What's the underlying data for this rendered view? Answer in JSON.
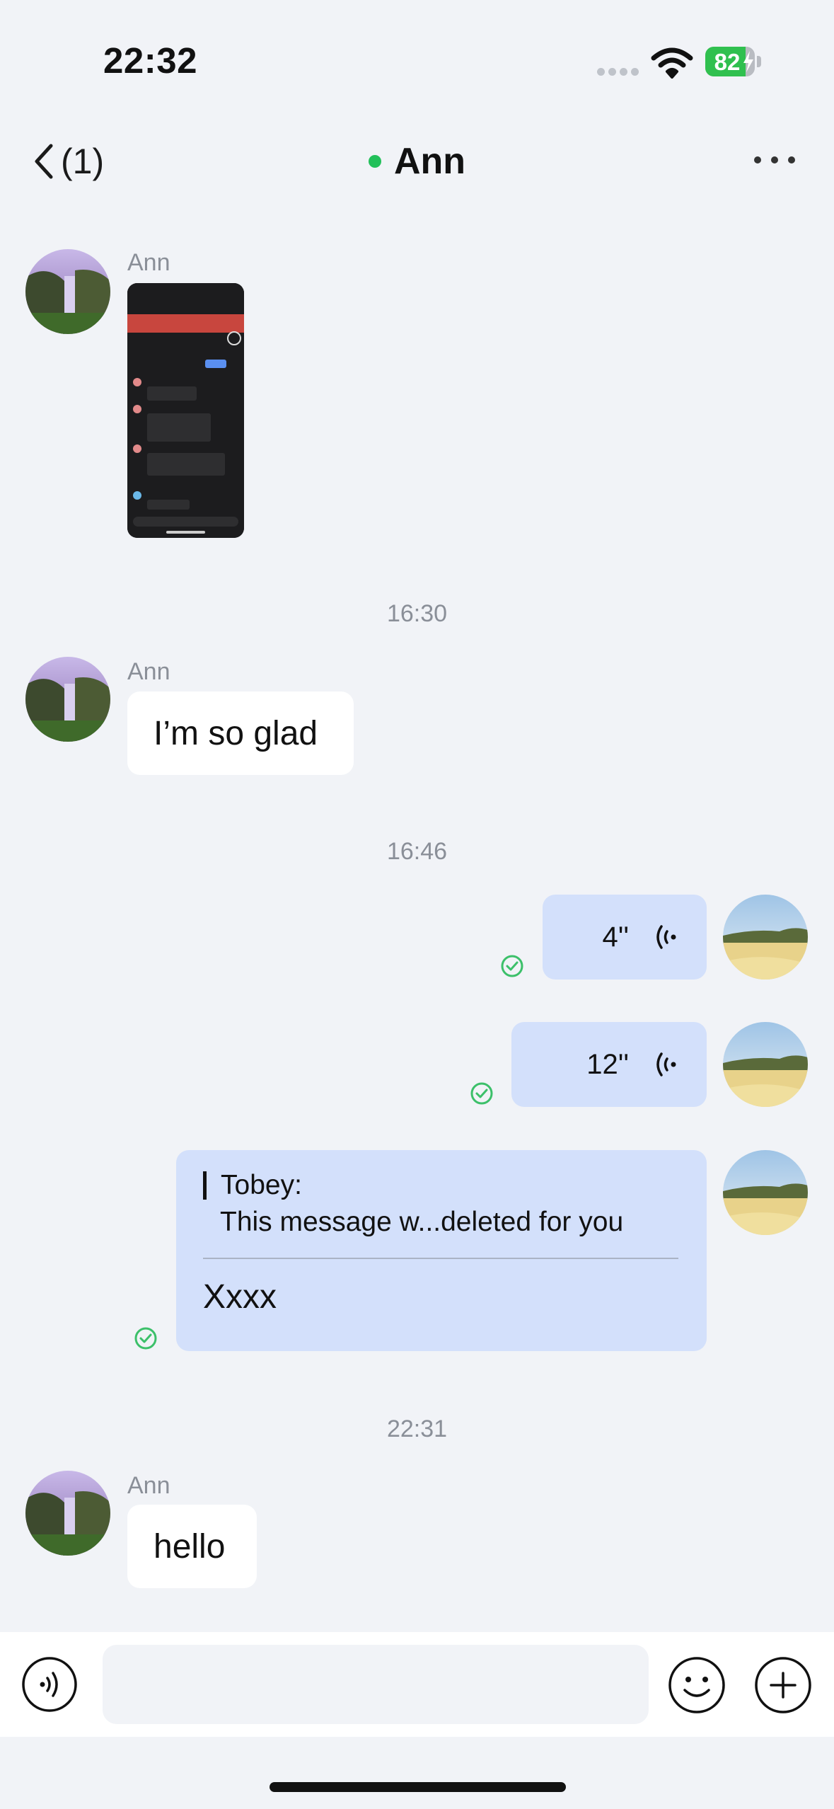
{
  "status_bar": {
    "time": "22:32",
    "battery_level": "82",
    "battery_percent": 82,
    "battery_color": "#30c04f",
    "icons": [
      "signal-dots-icon",
      "wifi-icon",
      "battery-charging-icon"
    ]
  },
  "nav": {
    "back_label": "(1)",
    "title": "Ann",
    "online_color": "#22c05a",
    "more_icon": "more-horizontal-icon"
  },
  "messages": [
    {
      "type": "image",
      "direction": "in",
      "sender": "Ann",
      "content": "phone-screenshot-thumbnail"
    },
    {
      "type": "time",
      "label": "16:30"
    },
    {
      "type": "text",
      "direction": "in",
      "sender": "Ann",
      "text": "I’m so glad"
    },
    {
      "type": "time",
      "label": "16:46"
    },
    {
      "type": "voice",
      "direction": "out",
      "duration": "4''",
      "status": "read"
    },
    {
      "type": "voice",
      "direction": "out",
      "duration": "12''",
      "status": "read"
    },
    {
      "type": "reply",
      "direction": "out",
      "quote_name": "Tobey:",
      "quote_text": "This message w...deleted for you",
      "text": "Xxxx",
      "status": "read"
    },
    {
      "type": "time",
      "label": "22:31"
    },
    {
      "type": "text",
      "direction": "in",
      "sender": "Ann",
      "text": "hello"
    }
  ],
  "colors": {
    "outgoing_bubble": "#d3e0fb",
    "incoming_bubble": "#ffffff",
    "read_check": "#3cc06a",
    "background": "#f1f3f7"
  },
  "composer": {
    "input_value": "",
    "icons": [
      "voice-input-icon",
      "emoji-icon",
      "plus-icon"
    ]
  }
}
